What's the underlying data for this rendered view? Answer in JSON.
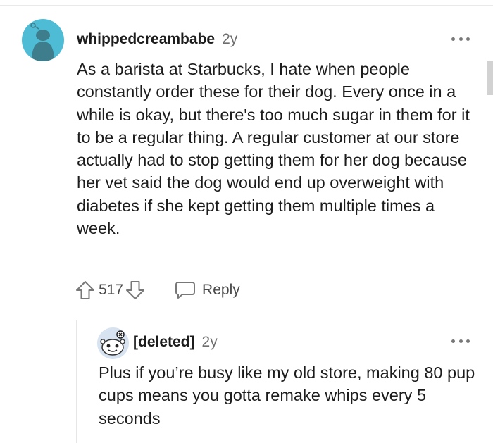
{
  "comment": {
    "username": "whippedcreambabe",
    "age": "2y",
    "body": "As a barista at Starbucks, I hate when people constantly order these for their dog. Every once in a while is okay, but there's too much sugar in them for it to be a regular thing. A regular customer at our store actually had to stop getting them for her dog because her vet said the dog would end up overweight with diabetes if she kept getting them multiple times a week.",
    "score": "517",
    "reply_label": "Reply",
    "avatar_color": "#4fbcd6"
  },
  "reply": {
    "username": "[deleted]",
    "age": "2y",
    "body": "Plus if you’re busy like my old store, making 80 pup cups means you gotta remake whips every 5 seconds",
    "avatar_color": "#d7e3f1"
  },
  "icons": {
    "upvote": "arrow-up-outline",
    "downvote": "arrow-down-outline",
    "reply": "speech-bubble",
    "more": "three-dots"
  }
}
